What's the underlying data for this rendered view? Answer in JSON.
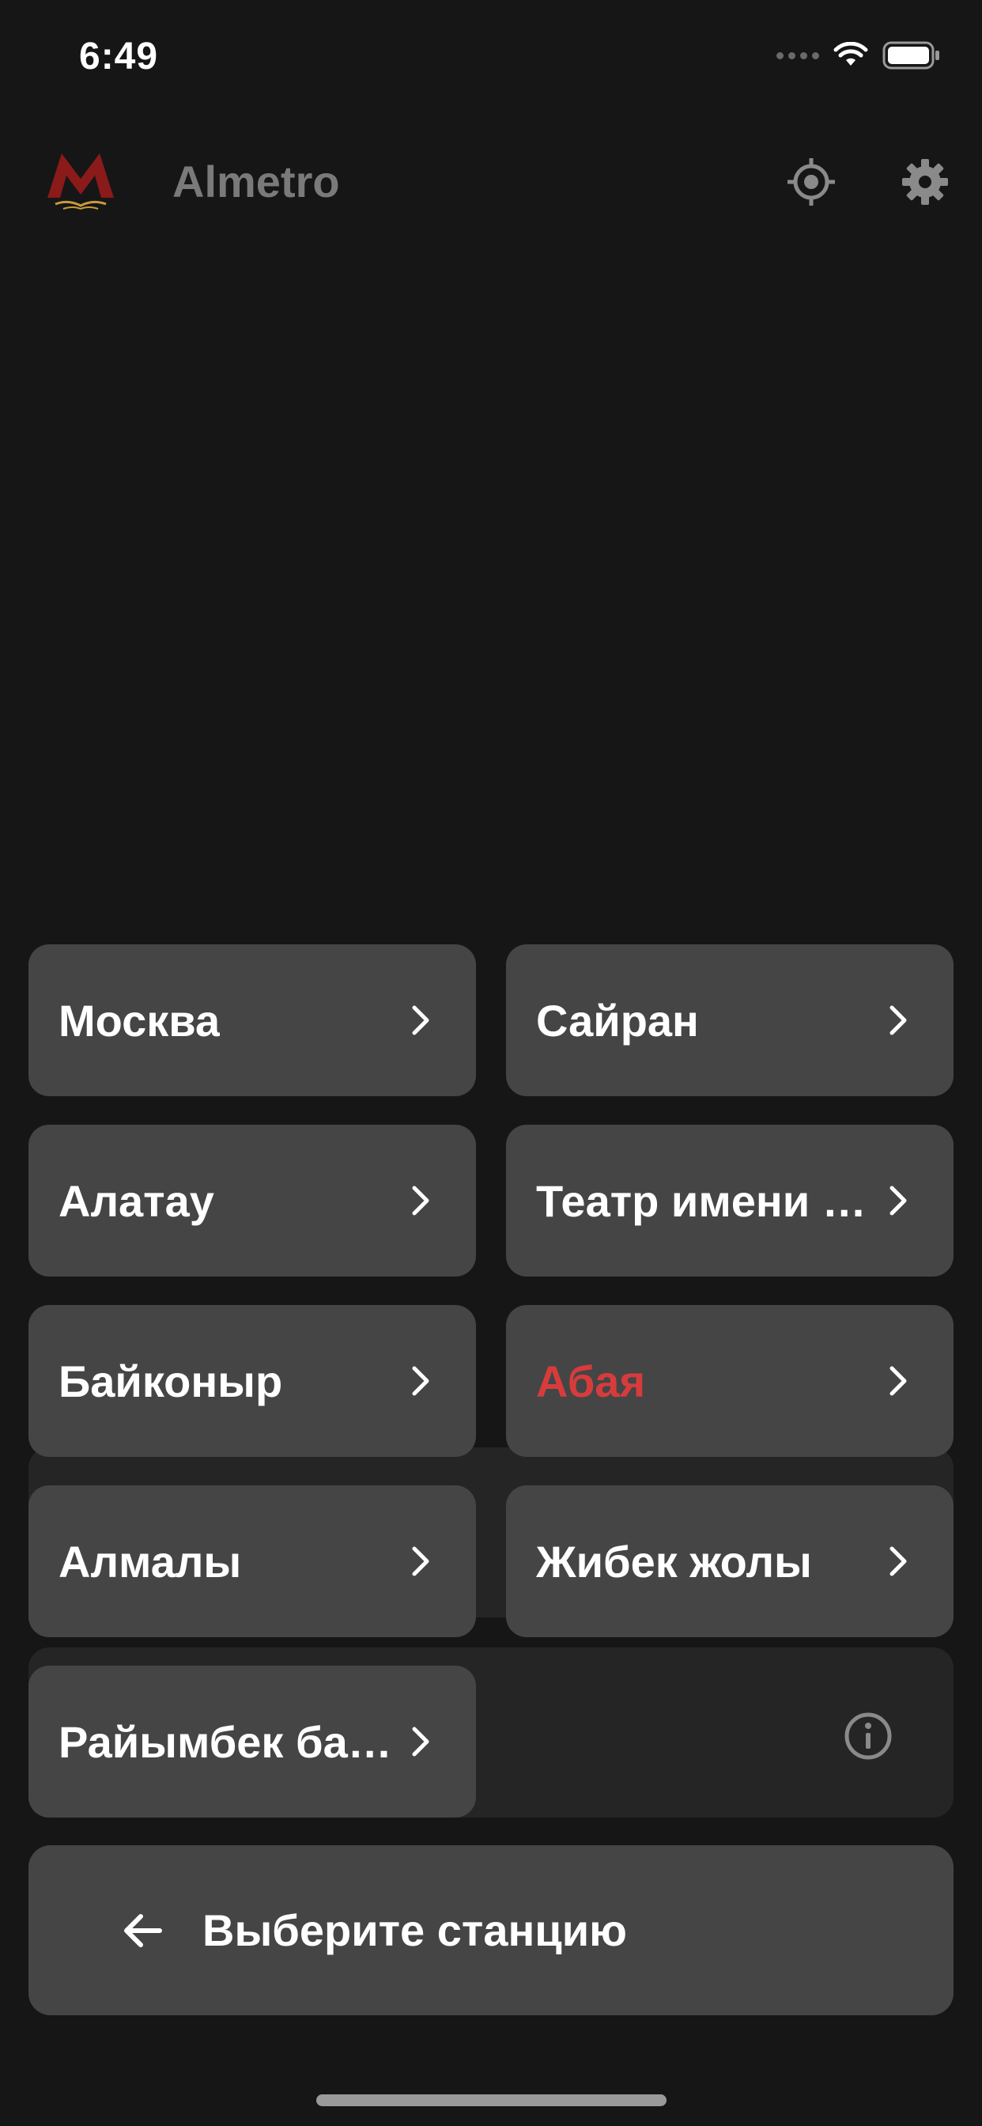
{
  "status_bar": {
    "time": "6:49"
  },
  "header": {
    "app_title": "Almetro",
    "logo_letter": "M"
  },
  "stations": [
    {
      "label": "Москва",
      "active": false
    },
    {
      "label": "Сайран",
      "active": false
    },
    {
      "label": "Алатау",
      "active": false
    },
    {
      "label": "Театр имени Мухтара Ауэзова",
      "active": false
    },
    {
      "label": "Байконыр",
      "active": false
    },
    {
      "label": "Абая",
      "active": true
    },
    {
      "label": "Алмалы",
      "active": false
    },
    {
      "label": "Жибек жолы",
      "active": false
    },
    {
      "label": "Райымбек батыра",
      "active": false
    }
  ],
  "bottom": {
    "select_station_label": "Выберите станцию"
  },
  "colors": {
    "background": "#161616",
    "card": "#454545",
    "active_station": "#d63c3c",
    "logo_red": "#8b1a1a",
    "logo_gold": "#c89b3c"
  },
  "icons": {
    "locate": "crosshair-icon",
    "settings": "gear-icon",
    "chevron": "chevron-right-icon",
    "info": "info-icon",
    "back": "arrow-left-icon"
  }
}
